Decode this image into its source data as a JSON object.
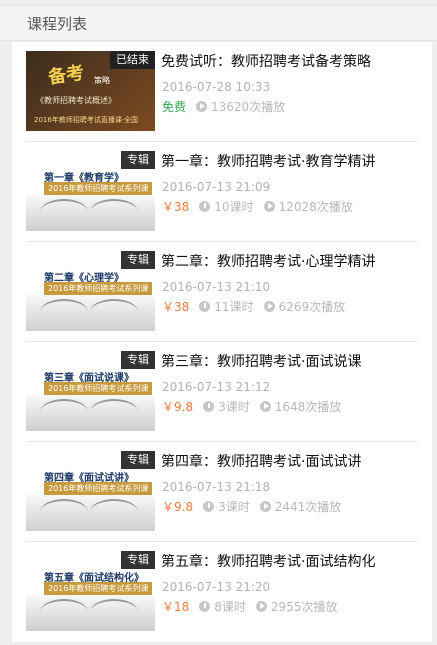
{
  "header": {
    "title": "课程列表"
  },
  "courses": [
    {
      "thumb_word": "备考",
      "thumb_line1": "策略",
      "thumb_line2": "《教师招聘考试概述》",
      "thumb_line3": "2016年教师招聘考试直播课·全国",
      "badge": "已结束",
      "title": "免费试听：教师招聘考试备考策略",
      "date": "2016-07-28 10:33",
      "price": "免费",
      "plays": "13620次播放"
    },
    {
      "thumb_line1": "第一章《教育学》",
      "thumb_line2": "2016年教师招聘考试系列课",
      "badge": "专辑",
      "title": "第一章：教师招聘考试·教育学精讲",
      "date": "2016-07-13 21:09",
      "price": "￥38",
      "lessons": "10课时",
      "plays": "12028次播放"
    },
    {
      "thumb_line1": "第二章《心理学》",
      "thumb_line2": "2016年教师招聘考试系列课",
      "badge": "专辑",
      "title": "第二章：教师招聘考试·心理学精讲",
      "date": "2016-07-13 21:10",
      "price": "￥38",
      "lessons": "11课时",
      "plays": "6269次播放"
    },
    {
      "thumb_line1": "第三章《面试说课》",
      "thumb_line2": "2016年教师招聘考试系列课",
      "badge": "专辑",
      "title": "第三章：教师招聘考试·面试说课",
      "date": "2016-07-13 21:12",
      "price": "￥9.8",
      "lessons": "3课时",
      "plays": "1648次播放"
    },
    {
      "thumb_line1": "第四章《面试试讲》",
      "thumb_line2": "2016年教师招聘考试系列课",
      "badge": "专辑",
      "title": "第四章：教师招聘考试·面试试讲",
      "date": "2016-07-13 21:18",
      "price": "￥9.8",
      "lessons": "3课时",
      "plays": "2441次播放"
    },
    {
      "thumb_line1": "第五章《面试结构化》",
      "thumb_line2": "2016年教师招聘考试系列课",
      "badge": "专辑",
      "title": "第五章：教师招聘考试·面试结构化",
      "date": "2016-07-13 21:20",
      "price": "￥18",
      "lessons": "8课时",
      "plays": "2955次播放"
    }
  ],
  "icons": {
    "clock": "clock-icon",
    "play": "play-icon"
  },
  "colors": {
    "price": "#f07a3a",
    "free": "#35a84f",
    "muted": "#b9b9b9"
  }
}
